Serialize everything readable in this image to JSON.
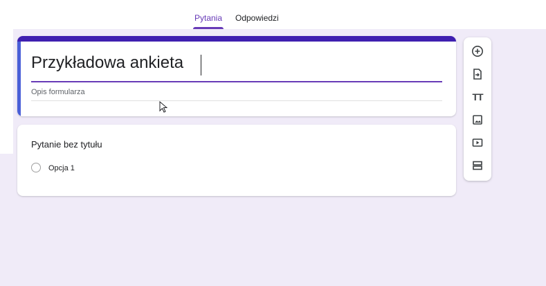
{
  "tabs": [
    {
      "label": "Pytania",
      "active": true
    },
    {
      "label": "Odpowiedzi",
      "active": false
    }
  ],
  "form": {
    "title": "Przykładowa ankieta",
    "description_placeholder": "Opis formularza"
  },
  "question": {
    "title": "Pytanie bez tytułu",
    "options": [
      "Opcja 1"
    ]
  },
  "toolbar": {
    "icons": [
      "add-question-icon",
      "import-questions-icon",
      "add-title-icon",
      "add-image-icon",
      "add-video-icon",
      "add-section-icon"
    ]
  },
  "colors": {
    "accent": "#673ab7",
    "header_band": "#3f1fb0",
    "active_edge": "#4a5fd8",
    "background": "#f0ebf8"
  }
}
